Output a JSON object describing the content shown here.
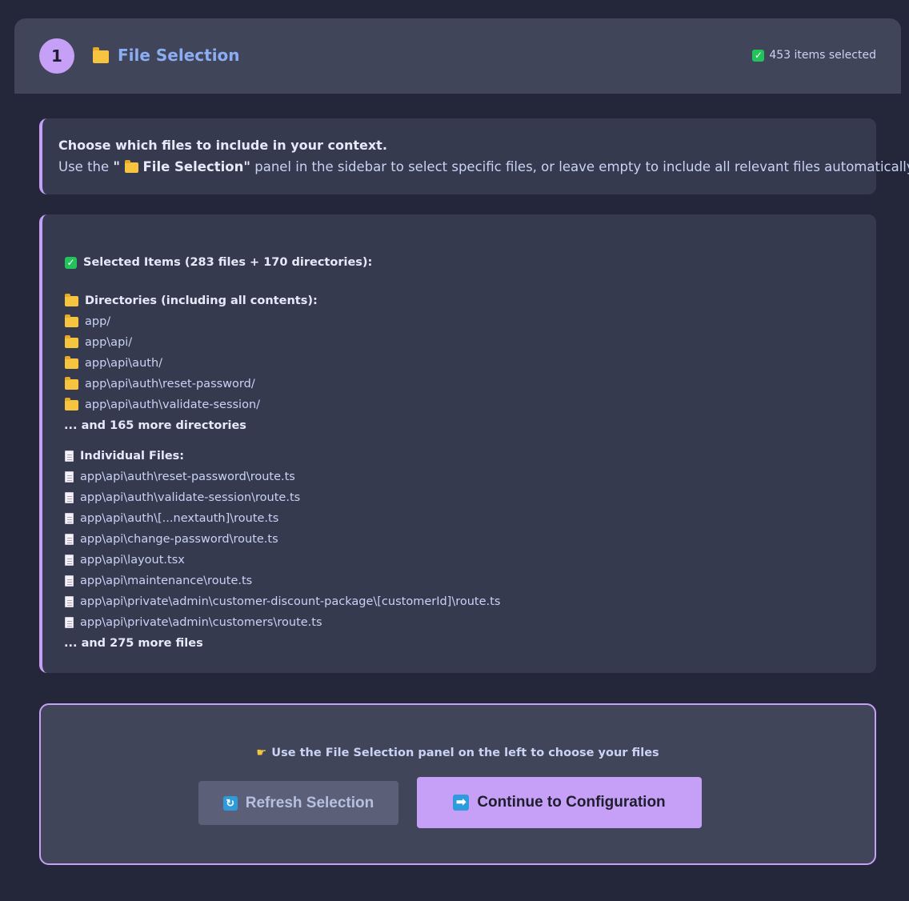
{
  "header": {
    "step_number": "1",
    "title": "File Selection",
    "status": "453 items selected"
  },
  "info": {
    "title": "Choose which files to include in your context.",
    "text_prefix": "Use the ",
    "text_quote_open": "\"",
    "panel_name": "File Selection",
    "text_quote_close": "\"",
    "text_suffix": " panel in the sidebar to select specific files, or leave empty to include all relevant files automatically."
  },
  "selection": {
    "heading": "Selected Items (283 files + 170 directories):",
    "directories_heading": "Directories (including all contents):",
    "directories": [
      "app/",
      "app\\api/",
      "app\\api\\auth/",
      "app\\api\\auth\\reset-password/",
      "app\\api\\auth\\validate-session/"
    ],
    "directories_more": "... and 165 more directories",
    "files_heading": "Individual Files:",
    "files": [
      "app\\api\\auth\\reset-password\\route.ts",
      "app\\api\\auth\\validate-session\\route.ts",
      "app\\api\\auth\\[...nextauth]\\route.ts",
      "app\\api\\change-password\\route.ts",
      "app\\api\\layout.tsx",
      "app\\api\\maintenance\\route.ts",
      "app\\api\\private\\admin\\customer-discount-package\\[customerId]\\route.ts",
      "app\\api\\private\\admin\\customers\\route.ts"
    ],
    "files_more": "... and 275 more files"
  },
  "actions": {
    "hint": "Use the File Selection panel on the left to choose your files",
    "refresh_label": "Refresh Selection",
    "continue_label": "Continue to Configuration"
  },
  "icons": {
    "header_badge": "step-number-badge",
    "header": "folder-icon",
    "status": "checkmark-icon",
    "directory": "folder-icon",
    "file": "document-icon",
    "hint": "pointing-hand-icon",
    "refresh": "refresh-icon",
    "continue": "right-arrow-icon"
  },
  "colors": {
    "accent": "#c6a0f6",
    "title": "#8aadf4",
    "background": "#24273a",
    "check": "#21c35a"
  }
}
